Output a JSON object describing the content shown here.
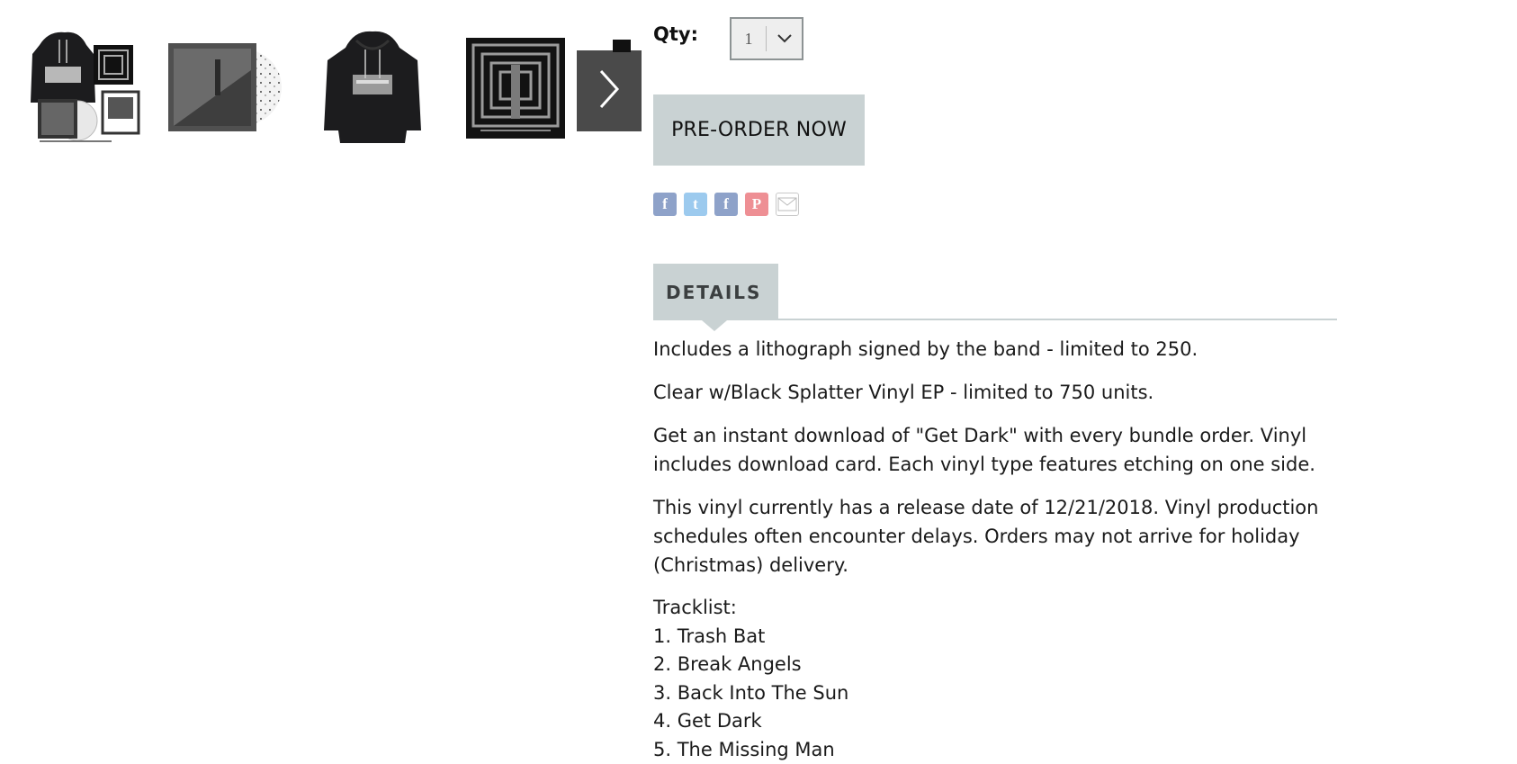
{
  "gallery": {
    "thumbs": [
      {
        "name": "bundle-hoodie-vinyl-litho"
      },
      {
        "name": "splatter-vinyl"
      },
      {
        "name": "black-hoodie"
      },
      {
        "name": "maze-album-art"
      }
    ],
    "next_icon": "chevron-right-icon"
  },
  "purchase": {
    "qty_label": "Qty:",
    "qty_value": "1",
    "preorder_label": "PRE-ORDER NOW"
  },
  "share": {
    "icons": [
      "facebook-icon",
      "twitter-icon",
      "facebook-share-icon",
      "pinterest-icon",
      "email-icon"
    ],
    "glyphs": [
      "f",
      "t",
      "f",
      "P",
      ""
    ]
  },
  "details": {
    "tab_label": "DETAILS",
    "paragraphs": [
      "Includes a lithograph signed by the band - limited to 250.",
      "Clear w/Black Splatter Vinyl EP - limited to 750 units.",
      "Get an instant download of \"Get Dark\" with every bundle order. Vinyl includes download card. Each vinyl type features etching on one side.",
      "This vinyl currently has a release date of 12/21/2018. Vinyl production schedules often encounter delays. Orders may not arrive for holiday (Christmas) delivery."
    ],
    "tracklist_heading": "Tracklist:",
    "tracks": [
      "1. Trash Bat",
      "2. Break Angels",
      "3. Back Into The Sun",
      "4. Get Dark",
      "5. The Missing Man"
    ]
  },
  "colors": {
    "button_bg": "#c9d2d3",
    "qty_border": "#8d9394",
    "next_bg": "#4a4a4a"
  }
}
